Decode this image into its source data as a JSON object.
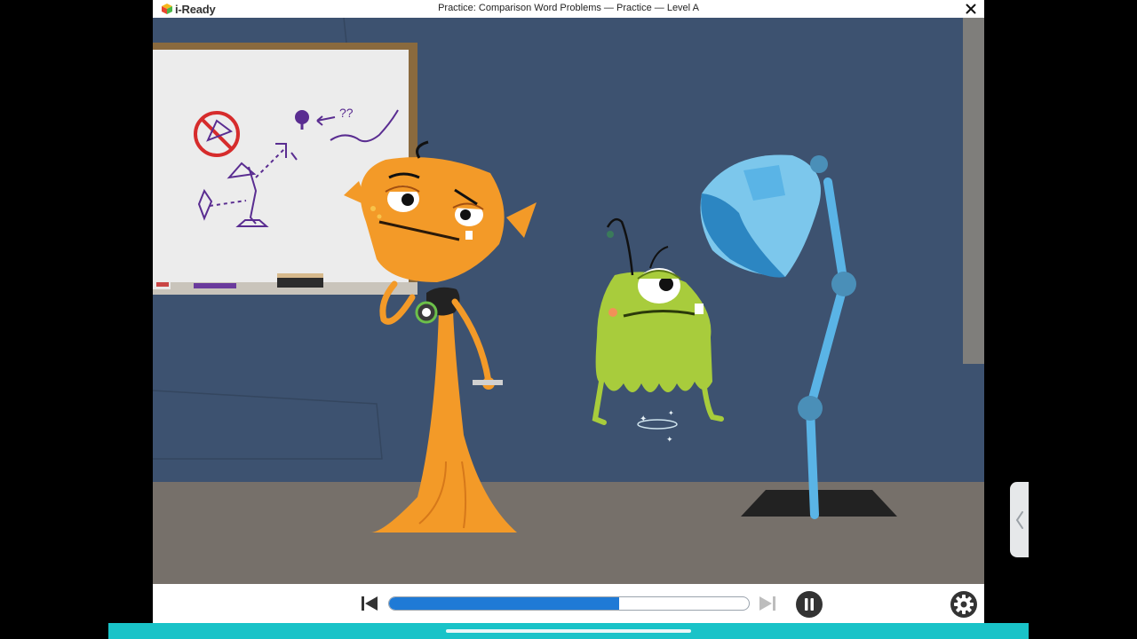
{
  "app": {
    "brand": "i-Ready",
    "title": "Practice: Comparison Word Problems — Practice — Level A",
    "close_icon": "close-icon"
  },
  "player": {
    "progress": 0.64,
    "prev_icon": "skip-back-icon",
    "next_icon": "skip-forward-icon",
    "pause_icon": "pause-icon",
    "settings_icon": "gear-icon"
  },
  "colors": {
    "accent": "#1f7ad6",
    "bottom_bar": "#19c3c8",
    "wall": "#3d5270",
    "floor": "#76706a",
    "orange_character": "#f39a28",
    "green_character": "#a8cc3c",
    "lamp": "#5ab4e6"
  },
  "side_tab_icon": "chevron-left-icon"
}
